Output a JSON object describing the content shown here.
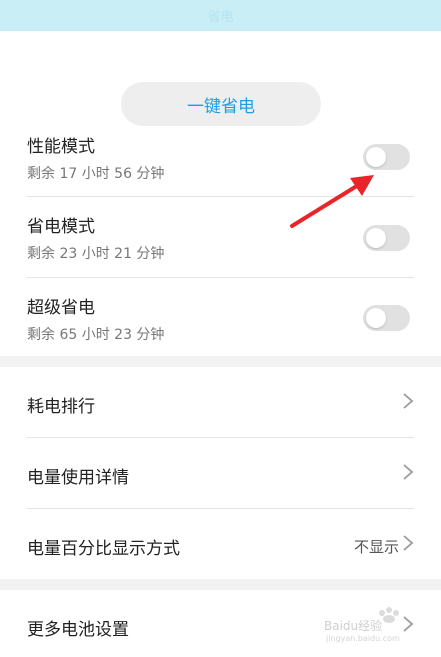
{
  "header": {
    "title": "省电"
  },
  "save_button": {
    "label": "一键省电"
  },
  "modes": [
    {
      "title": "性能模式",
      "remaining": "剩余 17 小时 56 分钟",
      "enabled": false
    },
    {
      "title": "省电模式",
      "remaining": "剩余 23 小时 21 分钟",
      "enabled": false
    },
    {
      "title": "超级省电",
      "remaining": "剩余 65 小时 23 分钟",
      "enabled": false
    }
  ],
  "menu": [
    {
      "label": "耗电排行",
      "value": ""
    },
    {
      "label": "电量使用详情",
      "value": ""
    },
    {
      "label": "电量百分比显示方式",
      "value": "不显示"
    }
  ],
  "more": {
    "label": "更多电池设置"
  },
  "watermark": {
    "text": "Baidu经验",
    "sub": "jingyan.baidu.com"
  },
  "colors": {
    "accent": "#1b9fe8",
    "annotation_arrow": "#e8262a",
    "header_bg": "#c9eef6"
  }
}
